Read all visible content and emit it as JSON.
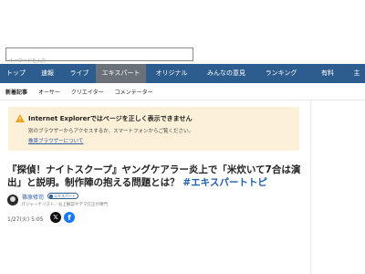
{
  "search": {
    "placeholder": "キーワードを入力",
    "value": ""
  },
  "nav": {
    "items": [
      {
        "label": "トップ"
      },
      {
        "label": "速報"
      },
      {
        "label": "ライブ"
      },
      {
        "label": "エキスパート",
        "active": true
      },
      {
        "label": "オリジナル"
      },
      {
        "label": "みんなの意見"
      },
      {
        "label": "ランキング"
      },
      {
        "label": "有料"
      },
      {
        "label": "主"
      }
    ],
    "active_color": "#6b7178",
    "background_color": "#2c5d8e"
  },
  "subnav": {
    "items": [
      {
        "label": "新着記事"
      },
      {
        "label": "オーサー"
      },
      {
        "label": "クリエイター"
      },
      {
        "label": "コメンテーター"
      }
    ]
  },
  "browser_warning": {
    "icon": "warning-icon",
    "title": "Internet Explorerではページを正しく表示できません",
    "text": "別のブラウザーからアクセスするか、スマートフォンからご覧ください。",
    "link": "推奨ブラウザーについて",
    "background_color": "#fdf0d8"
  },
  "article": {
    "headline": "『探偵！ナイトスクープ』ヤングケアラー炎上で「米炊いて7合は演出」と説明。制作陣の抱える問題とは？",
    "tag": "#エキスパートトピ",
    "tag_color": "#1f5fb0",
    "author": {
      "name": "篠原修司",
      "badge": "エキスパート",
      "description": "ITジャーナリスト／炎上解説やデマ訂正が専門"
    },
    "date": "1/27(火) 5:05",
    "share": {
      "x_icon": "x-share-icon",
      "facebook_icon": "facebook-share-icon",
      "x_glyph": "𝕏",
      "fb_glyph": "f"
    }
  }
}
